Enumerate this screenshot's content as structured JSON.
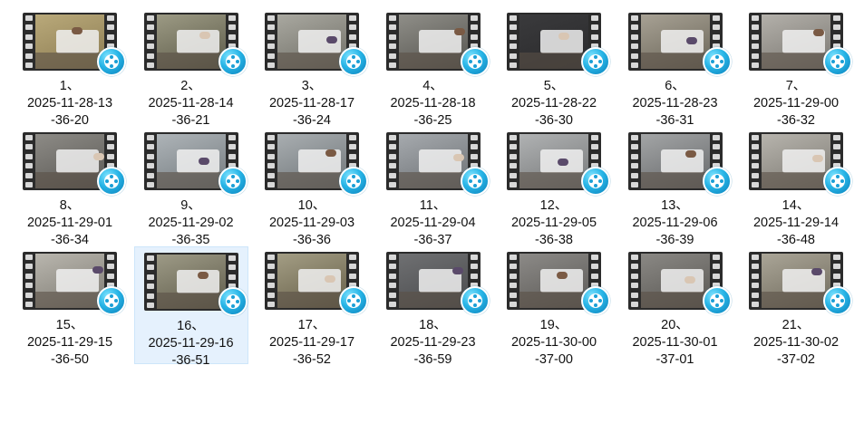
{
  "items": [
    {
      "line1": "1、",
      "line2": "2025-11-28-13",
      "line3": "-36-20",
      "tone": "#b9a97a",
      "bg": "#8c7c52",
      "selected": false
    },
    {
      "line1": "2、",
      "line2": "2025-11-28-14",
      "line3": "-36-21",
      "tone": "#9c9a84",
      "bg": "#5c5a48",
      "selected": false
    },
    {
      "line1": "3、",
      "line2": "2025-11-28-17",
      "line3": "-36-24",
      "tone": "#a9a8a0",
      "bg": "#6f6e66",
      "selected": false
    },
    {
      "line1": "4、",
      "line2": "2025-11-28-18",
      "line3": "-36-25",
      "tone": "#8f8e88",
      "bg": "#55544f",
      "selected": false
    },
    {
      "line1": "5、",
      "line2": "2025-11-28-22",
      "line3": "-36-30",
      "tone": "#3a3a3c",
      "bg": "#2a2a2c",
      "selected": false
    },
    {
      "line1": "6、",
      "line2": "2025-11-28-23",
      "line3": "-36-31",
      "tone": "#a7a194",
      "bg": "#6a6558",
      "selected": false
    },
    {
      "line1": "7、",
      "line2": "2025-11-29-00",
      "line3": "-36-32",
      "tone": "#b3b0aa",
      "bg": "#7a7771",
      "selected": false
    },
    {
      "line1": "8、",
      "line2": "2025-11-29-01",
      "line3": "-36-34",
      "tone": "#8d8b86",
      "bg": "#5a5854",
      "selected": false
    },
    {
      "line1": "9、",
      "line2": "2025-11-29-02",
      "line3": "-36-35",
      "tone": "#aeb4b8",
      "bg": "#737a7e",
      "selected": false
    },
    {
      "line1": "10、",
      "line2": "2025-11-29-03",
      "line3": "-36-36",
      "tone": "#a9aeb1",
      "bg": "#6e7477",
      "selected": false
    },
    {
      "line1": "11、",
      "line2": "2025-11-29-04",
      "line3": "-36-37",
      "tone": "#a6aaae",
      "bg": "#6c7074",
      "selected": false
    },
    {
      "line1": "12、",
      "line2": "2025-11-29-05",
      "line3": "-36-38",
      "tone": "#b0b2b3",
      "bg": "#767879",
      "selected": false
    },
    {
      "line1": "13、",
      "line2": "2025-11-29-06",
      "line3": "-36-39",
      "tone": "#a3a5a6",
      "bg": "#66686a",
      "selected": false
    },
    {
      "line1": "14、",
      "line2": "2025-11-29-14",
      "line3": "-36-48",
      "tone": "#b7b4ad",
      "bg": "#7c7972",
      "selected": false
    },
    {
      "line1": "15、",
      "line2": "2025-11-29-15",
      "line3": "-36-50",
      "tone": "#b9b6ae",
      "bg": "#7e7b73",
      "selected": false
    },
    {
      "line1": "16、",
      "line2": "2025-11-29-16",
      "line3": "-36-51",
      "tone": "#9d9a86",
      "bg": "#5e5b4a",
      "selected": true
    },
    {
      "line1": "17、",
      "line2": "2025-11-29-17",
      "line3": "-36-52",
      "tone": "#a39d84",
      "bg": "#665f48",
      "selected": false
    },
    {
      "line1": "18、",
      "line2": "2025-11-29-23",
      "line3": "-36-59",
      "tone": "#6f7072",
      "bg": "#4a4b4d",
      "selected": false
    },
    {
      "line1": "19、",
      "line2": "2025-11-30-00",
      "line3": "-37-00",
      "tone": "#8c8a87",
      "bg": "#5b5956",
      "selected": false
    },
    {
      "line1": "20、",
      "line2": "2025-11-30-01",
      "line3": "-37-01",
      "tone": "#8a8884",
      "bg": "#595753",
      "selected": false
    },
    {
      "line1": "21、",
      "line2": "2025-11-30-02",
      "line3": "-37-02",
      "tone": "#aaa597",
      "bg": "#6f6a5c",
      "selected": false
    }
  ],
  "icons": {
    "file_type": "video-file-icon",
    "badge": "media-player-badge-icon"
  },
  "colors": {
    "selection_bg": "#e5f1fd",
    "selection_border": "#cde6fa",
    "badge_accent": "#27b4e6"
  }
}
